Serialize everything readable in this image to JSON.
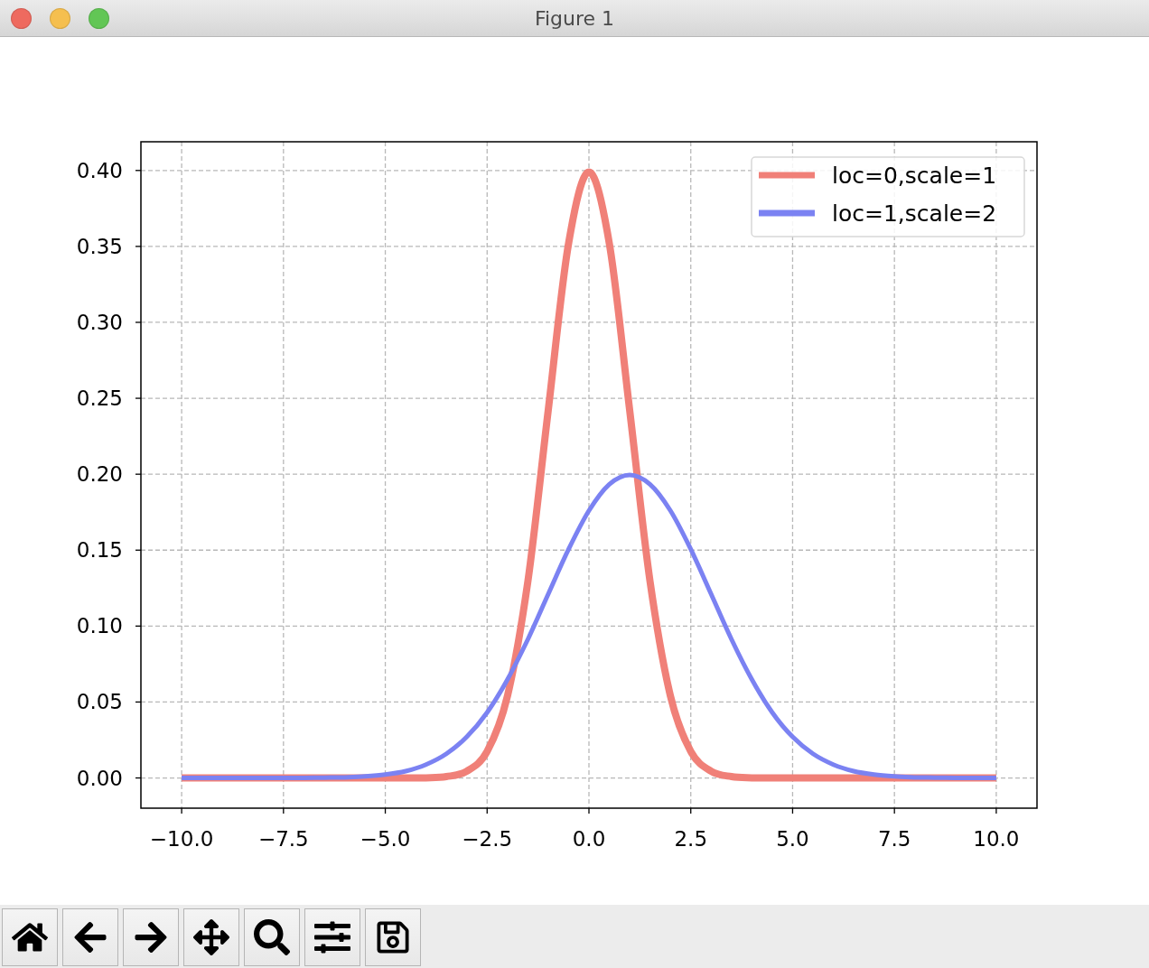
{
  "window": {
    "title": "Figure 1"
  },
  "figure": {
    "chart_data": {
      "type": "line",
      "x": [
        -10,
        -9.5,
        -9,
        -8.5,
        -8,
        -7.5,
        -7,
        -6.5,
        -6,
        -5.5,
        -5,
        -4.5,
        -4,
        -3.5,
        -3,
        -2.5,
        -2,
        -1.5,
        -1,
        -0.5,
        0,
        0.5,
        1,
        1.5,
        2,
        2.5,
        3,
        3.5,
        4,
        4.5,
        5,
        5.5,
        6,
        6.5,
        7,
        7.5,
        8,
        8.5,
        9,
        9.5,
        10
      ],
      "series": [
        {
          "name": "loc=0,scale=1",
          "color": "#f08078",
          "values": [
            0,
            0,
            0,
            0,
            0,
            0,
            0,
            0,
            0,
            0,
            0,
            0,
            0.0001,
            0.0009,
            0.0044,
            0.0175,
            0.054,
            0.1295,
            0.242,
            0.3521,
            0.3989,
            0.3521,
            0.242,
            0.1295,
            0.054,
            0.0175,
            0.0044,
            0.0009,
            0.0001,
            0,
            0,
            0,
            0,
            0,
            0,
            0,
            0,
            0,
            0,
            0,
            0
          ]
        },
        {
          "name": "loc=1,scale=2",
          "color": "#7b82f2",
          "values": [
            0,
            0,
            0,
            0,
            0,
            0,
            0.0001,
            0.0002,
            0.0004,
            0.001,
            0.0022,
            0.0045,
            0.0088,
            0.0159,
            0.027,
            0.0431,
            0.0648,
            0.0913,
            0.121,
            0.1506,
            0.176,
            0.1933,
            0.1995,
            0.1933,
            0.176,
            0.1506,
            0.121,
            0.0913,
            0.0648,
            0.0431,
            0.027,
            0.0159,
            0.0088,
            0.0045,
            0.0022,
            0.001,
            0.0004,
            0.0002,
            0.0001,
            0,
            0
          ]
        }
      ],
      "grid": true,
      "legend": true,
      "xlim": [
        -11,
        11
      ],
      "ylim": [
        -0.0199,
        0.4189
      ],
      "xticks": [
        {
          "value": -10,
          "label": "−10.0"
        },
        {
          "value": -7.5,
          "label": "−7.5"
        },
        {
          "value": -5,
          "label": "−5.0"
        },
        {
          "value": -2.5,
          "label": "−2.5"
        },
        {
          "value": 0,
          "label": "0.0"
        },
        {
          "value": 2.5,
          "label": "2.5"
        },
        {
          "value": 5,
          "label": "5.0"
        },
        {
          "value": 7.5,
          "label": "7.5"
        },
        {
          "value": 10,
          "label": "10.0"
        }
      ],
      "yticks": [
        {
          "value": 0,
          "label": "0.00"
        },
        {
          "value": 0.05,
          "label": "0.05"
        },
        {
          "value": 0.1,
          "label": "0.10"
        },
        {
          "value": 0.15,
          "label": "0.15"
        },
        {
          "value": 0.2,
          "label": "0.20"
        },
        {
          "value": 0.25,
          "label": "0.25"
        },
        {
          "value": 0.3,
          "label": "0.30"
        },
        {
          "value": 0.35,
          "label": "0.35"
        },
        {
          "value": 0.4,
          "label": "0.40"
        }
      ]
    }
  },
  "toolbar": {
    "buttons": [
      {
        "kind": "home"
      },
      {
        "kind": "back"
      },
      {
        "kind": "forward"
      },
      {
        "kind": "pan"
      },
      {
        "kind": "zoom"
      },
      {
        "kind": "configure"
      },
      {
        "kind": "save"
      }
    ]
  }
}
